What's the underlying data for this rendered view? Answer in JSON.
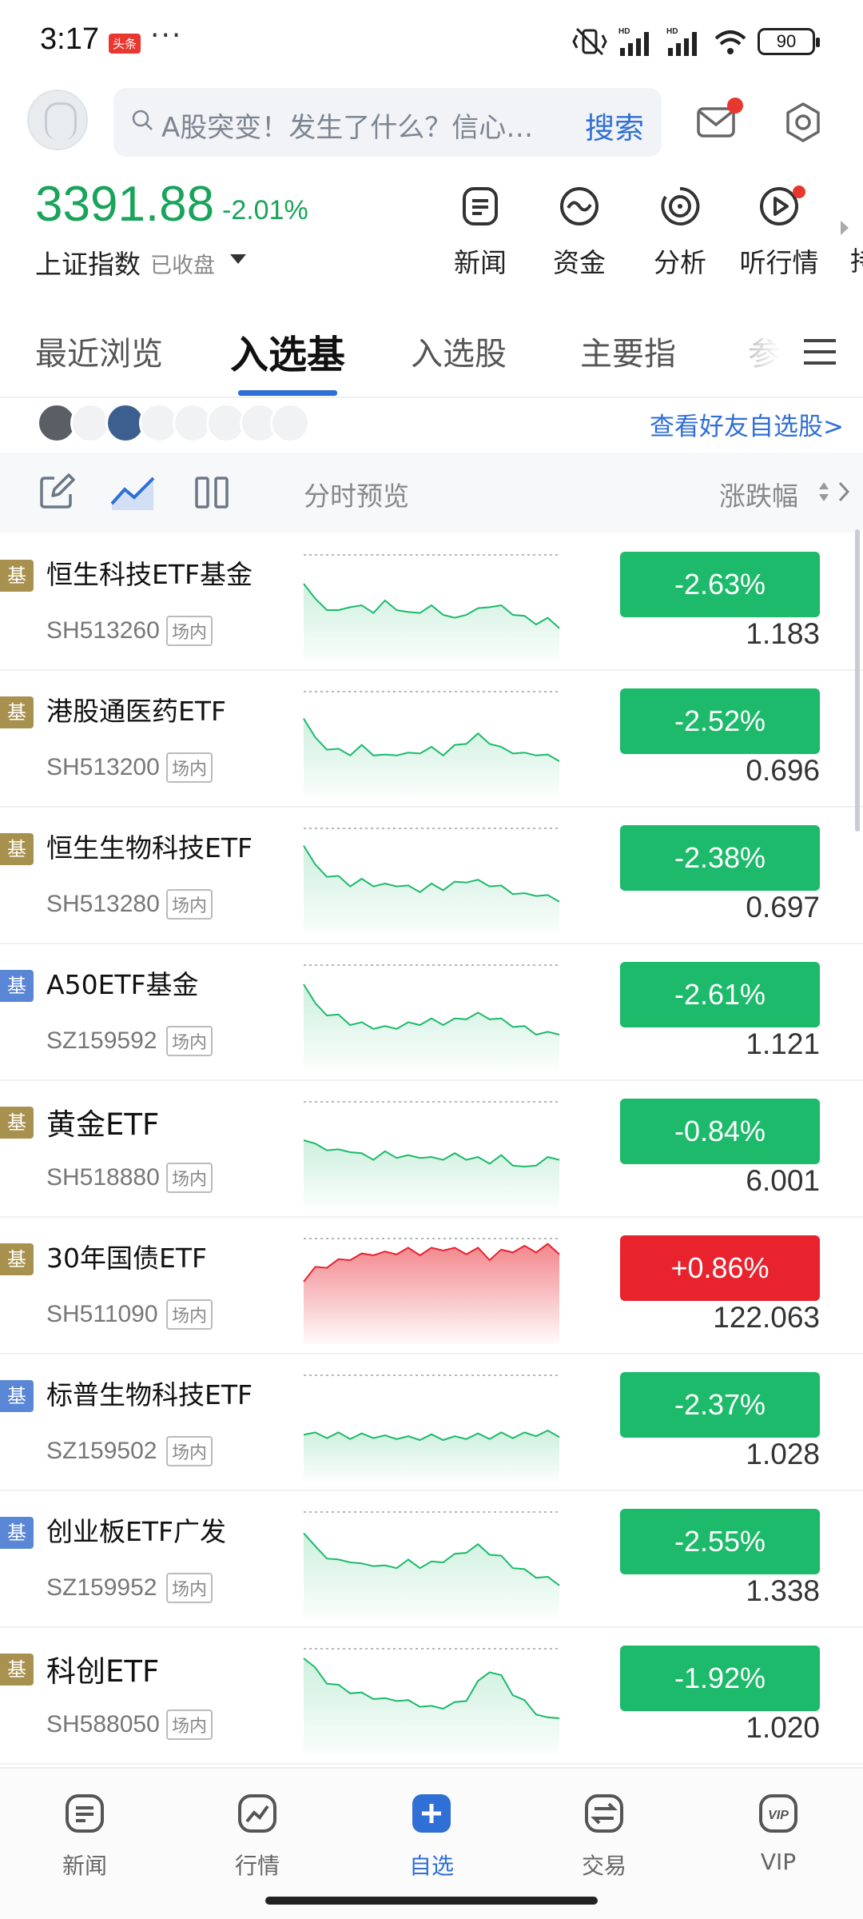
{
  "status_bar": {
    "time": "3:17",
    "badge": "头条",
    "more": "···",
    "battery": "90"
  },
  "header": {
    "search_placeholder": "A股突变！发生了什么？信心…",
    "search_button": "搜索"
  },
  "index": {
    "value": "3391.88",
    "change": "-2.01%",
    "name": "上证指数",
    "status": "已收盘"
  },
  "quick_actions": [
    {
      "label": "新闻",
      "icon": "news-icon"
    },
    {
      "label": "资金",
      "icon": "capital-icon"
    },
    {
      "label": "分析",
      "icon": "analysis-icon"
    },
    {
      "label": "听行情",
      "icon": "listen-icon"
    },
    {
      "label": "持",
      "icon": "holdings-icon"
    }
  ],
  "tabs": [
    "最近浏览",
    "入选基",
    "入选股",
    "主要指",
    "参"
  ],
  "active_tab": "入选基",
  "friends": {
    "link": "查看好友自选股>"
  },
  "toolbar": {
    "label": "分时预览",
    "sort_label": "涨跌幅"
  },
  "colors": {
    "up": "#e8232e",
    "down": "#1cba6a",
    "accent": "#2f6fd6",
    "tag_gold": "#a8914f",
    "tag_blue": "#5a86d6"
  },
  "funds": [
    {
      "tag": "基",
      "tag_color": "gold",
      "name": "恒生科技ETF基金",
      "code": "SH513260",
      "market": "场内",
      "change": "-2.63%",
      "price": "1.183",
      "direction": "down"
    },
    {
      "tag": "基",
      "tag_color": "gold",
      "name": "港股通医药ETF",
      "code": "SH513200",
      "market": "场内",
      "change": "-2.52%",
      "price": "0.696",
      "direction": "down"
    },
    {
      "tag": "基",
      "tag_color": "gold",
      "name": "恒生生物科技ETF",
      "code": "SH513280",
      "market": "场内",
      "change": "-2.38%",
      "price": "0.697",
      "direction": "down"
    },
    {
      "tag": "基",
      "tag_color": "blue",
      "name": "A50ETF基金",
      "code": "SZ159592",
      "market": "场内",
      "change": "-2.61%",
      "price": "1.121",
      "direction": "down"
    },
    {
      "tag": "基",
      "tag_color": "gold",
      "name": "黄金ETF",
      "code": "SH518880",
      "market": "场内",
      "change": "-0.84%",
      "price": "6.001",
      "direction": "down"
    },
    {
      "tag": "基",
      "tag_color": "gold",
      "name": "30年国债ETF",
      "code": "SH511090",
      "market": "场内",
      "change": "+0.86%",
      "price": "122.063",
      "direction": "up"
    },
    {
      "tag": "基",
      "tag_color": "blue",
      "name": "标普生物科技ETF",
      "code": "SZ159502",
      "market": "场内",
      "change": "-2.37%",
      "price": "1.028",
      "direction": "down"
    },
    {
      "tag": "基",
      "tag_color": "blue",
      "name": "创业板ETF广发",
      "code": "SZ159952",
      "market": "场内",
      "change": "-2.55%",
      "price": "1.338",
      "direction": "down"
    },
    {
      "tag": "基",
      "tag_color": "gold",
      "name": "科创ETF",
      "code": "SH588050",
      "market": "场内",
      "change": "-1.92%",
      "price": "1.020",
      "direction": "down"
    }
  ],
  "bottom_nav": [
    {
      "label": "新闻",
      "icon": "news-tab-icon"
    },
    {
      "label": "行情",
      "icon": "market-tab-icon"
    },
    {
      "label": "自选",
      "icon": "watchlist-tab-icon",
      "active": true
    },
    {
      "label": "交易",
      "icon": "trade-tab-icon"
    },
    {
      "label": "VIP",
      "icon": "vip-tab-icon"
    }
  ]
}
